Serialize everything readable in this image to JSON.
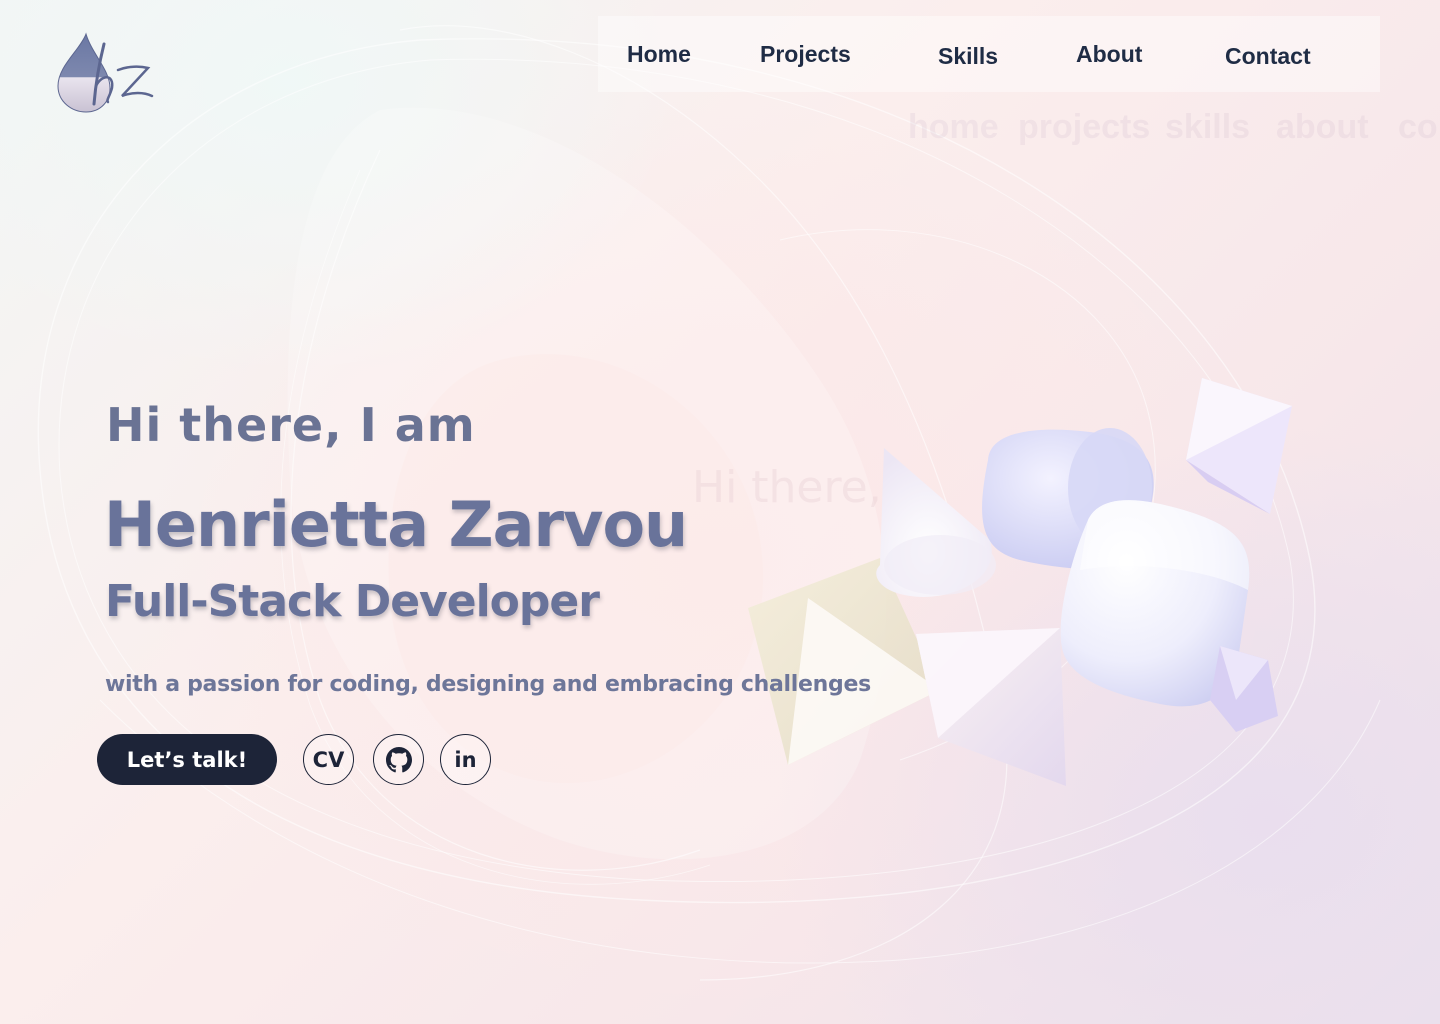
{
  "logo": {
    "icon": "drop-logo-icon",
    "text": "hz"
  },
  "nav": {
    "items": [
      {
        "label": "Home"
      },
      {
        "label": "Projects"
      },
      {
        "label": "Skills"
      },
      {
        "label": "About"
      },
      {
        "label": "Contact"
      }
    ],
    "ghost_items": [
      "home",
      "projects",
      "skills",
      "about",
      "co"
    ]
  },
  "hero": {
    "greeting": "Hi there, I am",
    "ghost_greeting": "Hi there,",
    "name": "Henrietta Zarvou",
    "role": "Full-Stack Developer",
    "tagline": "with a passion for coding, designing and embracing challenges"
  },
  "actions": {
    "cta_label": "Let’s talk!",
    "cv_label": "CV",
    "github_icon": "github-icon",
    "linkedin_label": "in",
    "linkedin_icon": "linkedin-icon"
  },
  "colors": {
    "text_primary": "#69739a",
    "nav_text": "#1f2c45",
    "button_dark": "#1d2438"
  }
}
